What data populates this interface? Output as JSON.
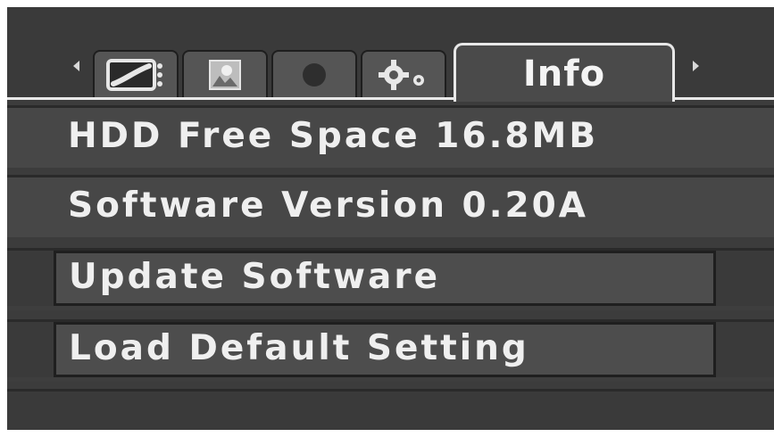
{
  "tabs": [
    {
      "icon": "tv-icon"
    },
    {
      "icon": "photo-icon"
    },
    {
      "icon": "record-icon"
    },
    {
      "icon": "gear-icon"
    },
    {
      "label": "Info"
    }
  ],
  "nav": {
    "left_icon": "arrow-left-icon",
    "right_icon": "arrow-right-icon"
  },
  "info": {
    "hdd_free_space": "HDD Free Space 16.8MB",
    "software_version": "Software Version 0.20A",
    "update_software": "Update Software",
    "load_default_setting": "Load Default Setting"
  },
  "colors": {
    "background": "#3c3c3c",
    "text": "#efefef",
    "active_tab_border": "#e8e8e8"
  }
}
